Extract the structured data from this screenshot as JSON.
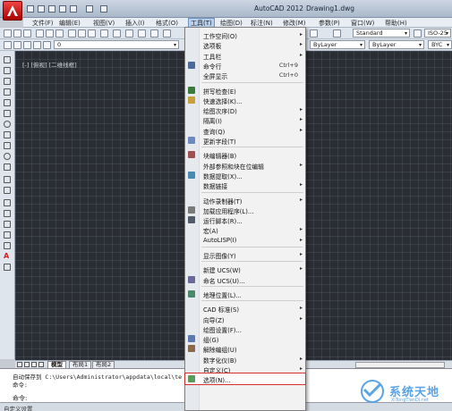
{
  "window": {
    "app_title": "AutoCAD 2012",
    "file_title": "Drawing1.dwg"
  },
  "menubar": [
    {
      "label": "文件(F)",
      "active": false
    },
    {
      "label": "编辑(E)",
      "active": false
    },
    {
      "label": "视图(V)",
      "active": false
    },
    {
      "label": "插入(I)",
      "active": false
    },
    {
      "label": "格式(O)",
      "active": false
    },
    {
      "label": "工具(T)",
      "active": true
    },
    {
      "label": "绘图(D)",
      "active": false
    },
    {
      "label": "标注(N)",
      "active": false
    },
    {
      "label": "修改(M)",
      "active": false
    },
    {
      "label": "参数(P)",
      "active": false
    },
    {
      "label": "窗口(W)",
      "active": false
    },
    {
      "label": "帮助(H)",
      "active": false
    }
  ],
  "toolbar": {
    "text_style": "Standard",
    "dim_style": "ISO-25",
    "layer_value": "0",
    "bylayer_1": "ByLayer",
    "bylayer_2": "ByLayer",
    "linetype_right": "BYC"
  },
  "viewport_label": "[-] [俯视] [二维线框]",
  "tools_menu": [
    {
      "type": "item",
      "label": "工作空间(O)",
      "submenu": true,
      "icon": "none"
    },
    {
      "type": "item",
      "label": "选项板",
      "submenu": true,
      "icon": "none"
    },
    {
      "type": "item",
      "label": "工具栏",
      "submenu": true,
      "icon": "none"
    },
    {
      "type": "item",
      "label": "命令行",
      "shortcut": "Ctrl+9",
      "icon": "command-line-icon"
    },
    {
      "type": "item",
      "label": "全屏显示",
      "shortcut": "Ctrl+0",
      "icon": "none"
    },
    {
      "type": "separator"
    },
    {
      "type": "item",
      "label": "拼写检查(E)",
      "icon": "spell-check-icon"
    },
    {
      "type": "item",
      "label": "快速选择(K)...",
      "icon": "quick-select-icon"
    },
    {
      "type": "item",
      "label": "绘图次序(D)",
      "submenu": true,
      "icon": "none"
    },
    {
      "type": "item",
      "label": "隔离(I)",
      "submenu": true,
      "icon": "none"
    },
    {
      "type": "item",
      "label": "查询(Q)",
      "submenu": true,
      "icon": "none"
    },
    {
      "type": "item",
      "label": "更新字段(T)",
      "icon": "update-fields-icon"
    },
    {
      "type": "separator"
    },
    {
      "type": "item",
      "label": "块编辑器(B)",
      "icon": "block-editor-icon"
    },
    {
      "type": "item",
      "label": "外部参照和块在位编辑",
      "submenu": true,
      "icon": "none"
    },
    {
      "type": "item",
      "label": "数据提取(X)...",
      "icon": "data-extraction-icon"
    },
    {
      "type": "item",
      "label": "数据链接",
      "submenu": true,
      "icon": "none"
    },
    {
      "type": "separator"
    },
    {
      "type": "item",
      "label": "动作录制器(T)",
      "submenu": true,
      "icon": "none"
    },
    {
      "type": "item",
      "label": "加载应用程序(L)...",
      "icon": "load-app-icon"
    },
    {
      "type": "item",
      "label": "运行脚本(R)...",
      "icon": "run-script-icon"
    },
    {
      "type": "item",
      "label": "宏(A)",
      "submenu": true,
      "icon": "none"
    },
    {
      "type": "item",
      "label": "AutoLISP(I)",
      "submenu": true,
      "icon": "none"
    },
    {
      "type": "separator"
    },
    {
      "type": "item",
      "label": "显示图像(Y)",
      "submenu": true,
      "icon": "none"
    },
    {
      "type": "separator"
    },
    {
      "type": "item",
      "label": "新建 UCS(W)",
      "submenu": true,
      "icon": "none"
    },
    {
      "type": "item",
      "label": "命名 UCS(U)...",
      "icon": "named-ucs-icon"
    },
    {
      "type": "separator"
    },
    {
      "type": "item",
      "label": "地理位置(L)...",
      "icon": "geo-location-icon"
    },
    {
      "type": "separator"
    },
    {
      "type": "item",
      "label": "CAD 标准(S)",
      "submenu": true,
      "icon": "none"
    },
    {
      "type": "item",
      "label": "向导(Z)",
      "submenu": true,
      "icon": "none"
    },
    {
      "type": "item",
      "label": "绘图设置(F)...",
      "icon": "none"
    },
    {
      "type": "item",
      "label": "组(G)",
      "icon": "group-icon"
    },
    {
      "type": "item",
      "label": "解除编组(U)",
      "icon": "ungroup-icon"
    },
    {
      "type": "item",
      "label": "数字化仪(B)",
      "submenu": true,
      "icon": "none"
    },
    {
      "type": "item",
      "label": "自定义(C)",
      "submenu": true,
      "icon": "none"
    },
    {
      "type": "item",
      "label": "选项(N)...",
      "icon": "options-icon",
      "highlight": true
    }
  ],
  "layout_tabs": [
    "模型",
    "布局1",
    "布局2"
  ],
  "command": {
    "line1": "自动保存到 C:\\Users\\Administrator\\appdata\\local\\te",
    "line2": "命令:",
    "prompt": "命令:"
  },
  "statusbar": {
    "text": "自定义设置"
  },
  "watermark": {
    "text": "系统天地",
    "sub": "XiTongTianDi.net"
  },
  "colors": {
    "drawing_bg": "#2a2d33",
    "menu_bg": "#f2f2f2",
    "highlight_border": "#d43030",
    "watermark": "#5aa3e6"
  }
}
